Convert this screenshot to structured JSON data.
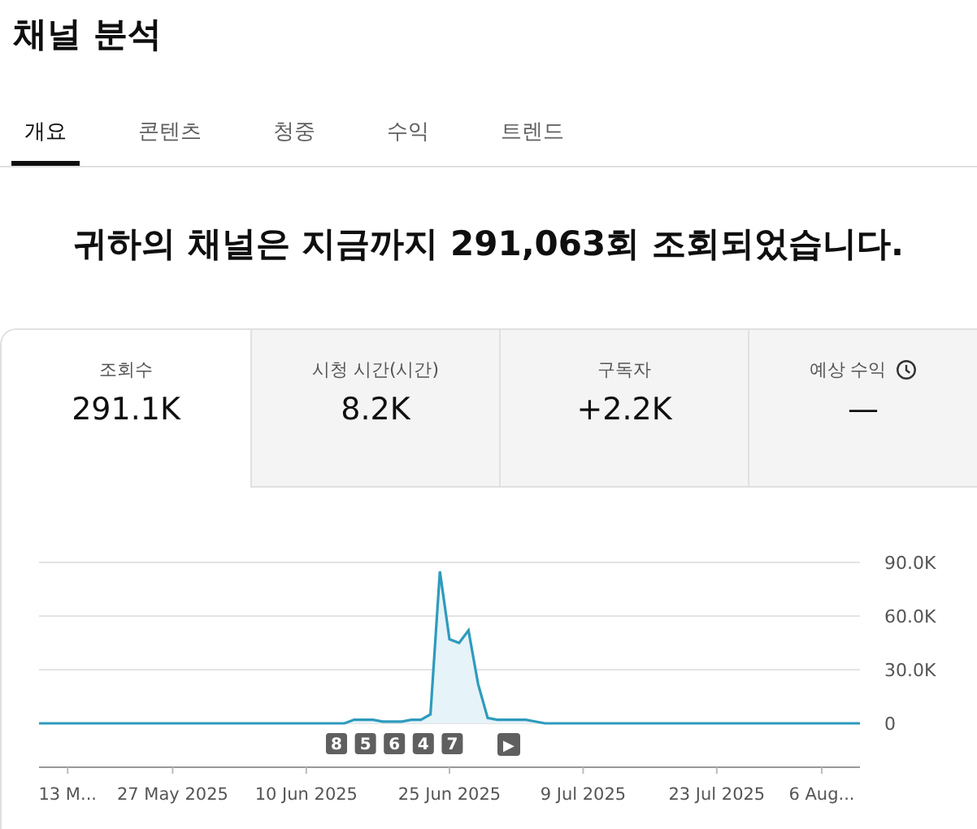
{
  "title": "채널 분석",
  "tabs": [
    {
      "label": "개요",
      "selected": true
    },
    {
      "label": "콘텐츠",
      "selected": false
    },
    {
      "label": "청중",
      "selected": false
    },
    {
      "label": "수익",
      "selected": false
    },
    {
      "label": "트렌드",
      "selected": false
    }
  ],
  "headline": "귀하의 채널은 지금까지 291,063회 조회되었습니다.",
  "metrics": [
    {
      "label": "조회수",
      "value": "291.1K",
      "selected": true,
      "clock": false
    },
    {
      "label": "시청 시간(시간)",
      "value": "8.2K",
      "selected": false,
      "clock": false
    },
    {
      "label": "구독자",
      "value": "+2.2K",
      "selected": false,
      "clock": false
    },
    {
      "label": "예상 수익",
      "value": "—",
      "selected": false,
      "clock": true
    }
  ],
  "chart": {
    "chart_data": {
      "type": "area",
      "categories": [
        null,
        null,
        null,
        "13 M...",
        null,
        null,
        null,
        null,
        null,
        null,
        null,
        null,
        null,
        null,
        "27 May 2025",
        null,
        null,
        null,
        null,
        null,
        null,
        null,
        null,
        null,
        null,
        null,
        null,
        null,
        "10 Jun 2025",
        null,
        null,
        null,
        null,
        null,
        null,
        null,
        null,
        null,
        null,
        null,
        null,
        null,
        null,
        "25 Jun 2025",
        null,
        null,
        null,
        null,
        null,
        null,
        null,
        null,
        null,
        null,
        null,
        null,
        null,
        "9 Jul 2025",
        null,
        null,
        null,
        null,
        null,
        null,
        null,
        null,
        null,
        null,
        null,
        null,
        null,
        "23 Jul 2025",
        null,
        null,
        null,
        null,
        null,
        null,
        null,
        null,
        null,
        null,
        "6 Aug...",
        null,
        null,
        null,
        null
      ],
      "series": [
        {
          "color": "#2e9bbd",
          "values": [
            0,
            0,
            0,
            0,
            0,
            0,
            0,
            0,
            0,
            0,
            0,
            0,
            0,
            0,
            0,
            0,
            0,
            0,
            0,
            0,
            0,
            0,
            0,
            0,
            0,
            0,
            0,
            0,
            0,
            0,
            0,
            0,
            0,
            2000,
            2000,
            2000,
            1000,
            1000,
            1000,
            2000,
            2000,
            5000,
            85000,
            47000,
            45000,
            52000,
            22000,
            3000,
            2000,
            2000,
            2000,
            2000,
            1000,
            0,
            0,
            0,
            0,
            0,
            0,
            0,
            0,
            0,
            0,
            0,
            0,
            0,
            0,
            0,
            0,
            0,
            0,
            0,
            0,
            0,
            0,
            0,
            0,
            0,
            0,
            0,
            0,
            0,
            0,
            0,
            0,
            0,
            0
          ]
        }
      ],
      "ylim": [
        0,
        90000
      ],
      "yticks": [
        {
          "value": 0,
          "label": "0"
        },
        {
          "value": 30000,
          "label": "30.0K"
        },
        {
          "value": 60000,
          "label": "60.0K"
        },
        {
          "value": 90000,
          "label": "90.0K"
        }
      ]
    },
    "markers": [
      "8",
      "5",
      "6",
      "4",
      "7"
    ],
    "next_button": "▶"
  }
}
